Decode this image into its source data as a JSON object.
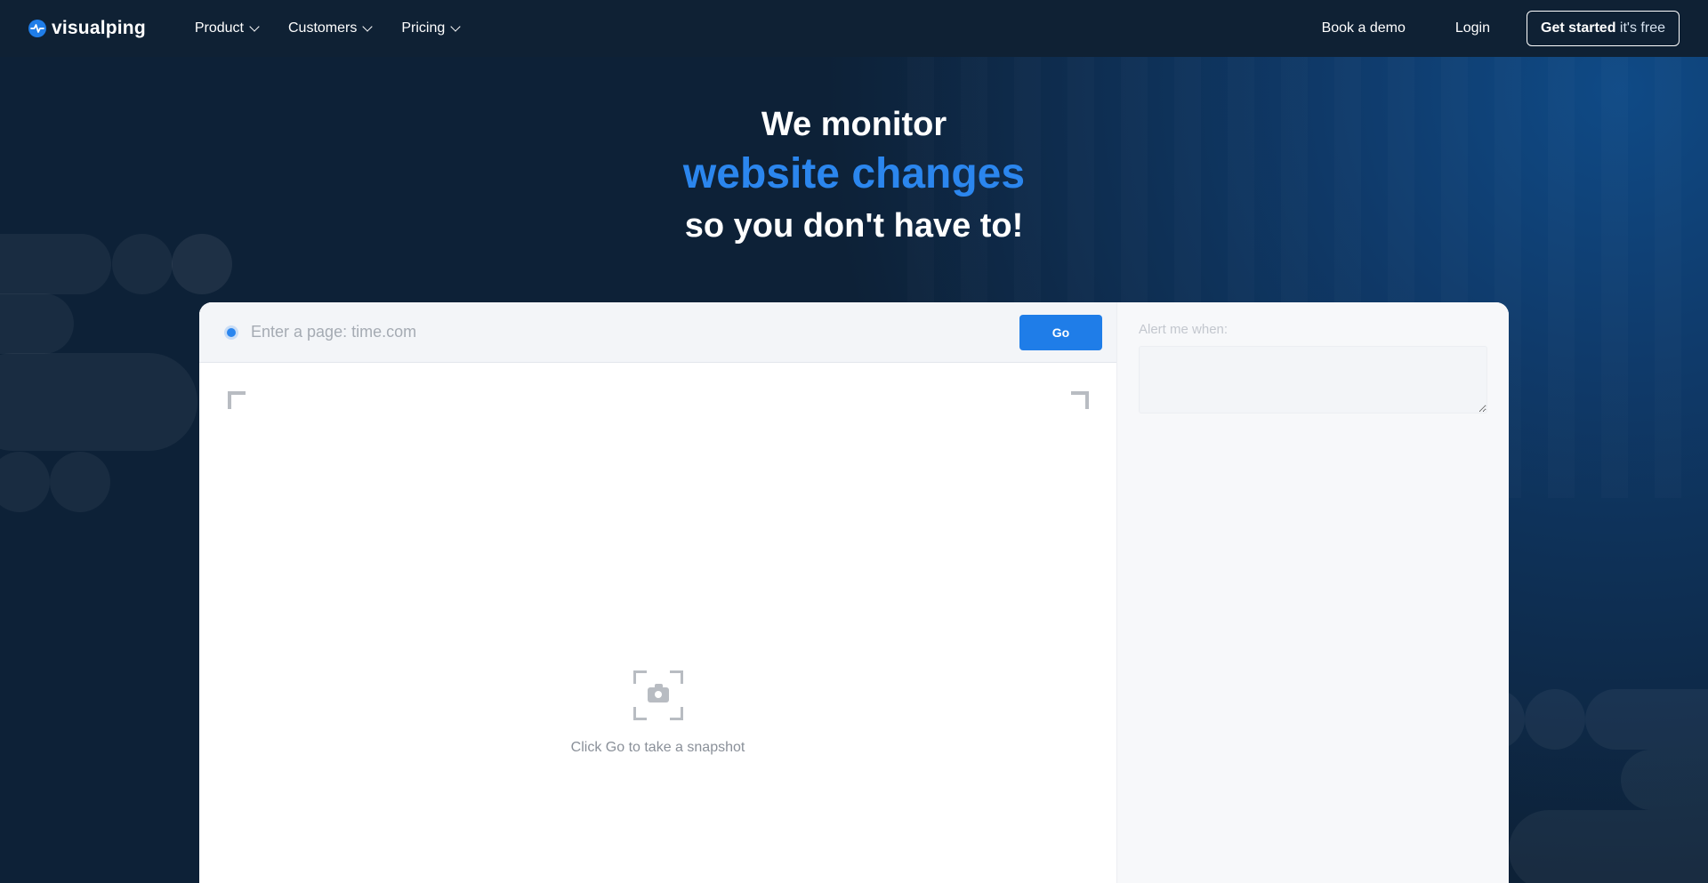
{
  "brand": {
    "name": "visualping"
  },
  "nav": {
    "items": [
      {
        "label": "Product"
      },
      {
        "label": "Customers"
      },
      {
        "label": "Pricing"
      }
    ],
    "book_demo": "Book a demo",
    "login": "Login",
    "cta_bold": "Get started",
    "cta_light": "it's free"
  },
  "hero": {
    "line1": "We monitor",
    "line2": "website changes",
    "line3": "so you don't have to!"
  },
  "monitor": {
    "url_placeholder": "Enter a page: time.com",
    "url_value": "",
    "go_label": "Go",
    "snapshot_hint": "Click Go to take a snapshot",
    "alert_label": "Alert me when:",
    "alert_value": ""
  },
  "colors": {
    "background": "#0d2137",
    "accent": "#1f7de8",
    "headline_accent": "#2b86ee"
  }
}
